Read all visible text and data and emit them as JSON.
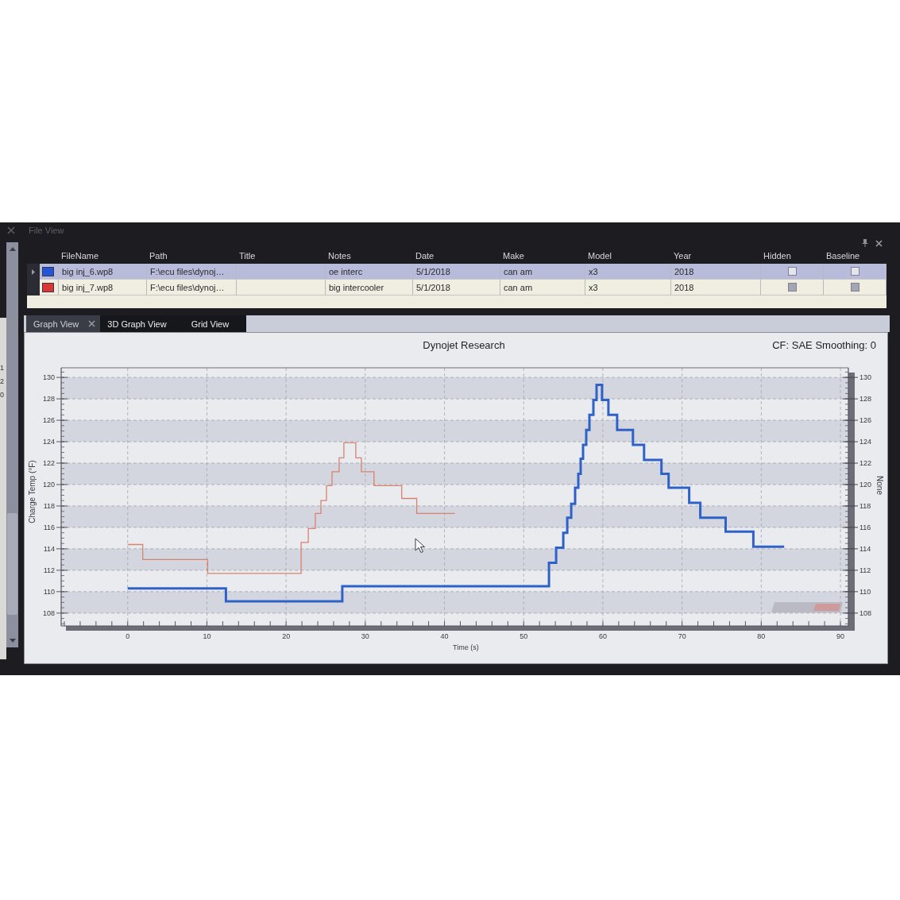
{
  "window": {
    "title": "File View"
  },
  "left_edge": {
    "lines": [
      "1",
      "2",
      "0"
    ]
  },
  "file_view": {
    "columns": [
      "FileName",
      "Path",
      "Title",
      "Notes",
      "Date",
      "Make",
      "Model",
      "Year",
      "Hidden",
      "Baseline"
    ],
    "rows": [
      {
        "selected": true,
        "color": "#2454d8",
        "file_name": "big inj_6.wp8",
        "path": "F:\\ecu files\\dynoj…",
        "notes": "oe interc",
        "date": "5/1/2018",
        "make": "can am",
        "model": "x3",
        "year": "2018",
        "hidden": false,
        "baseline": false
      },
      {
        "selected": false,
        "color": "#dd3535",
        "file_name": "big inj_7.wp8",
        "path": "F:\\ecu files\\dynoj…",
        "notes": "big intercooler",
        "date": "5/1/2018",
        "make": "can am",
        "model": "x3",
        "year": "2018",
        "hidden": false,
        "baseline": false
      }
    ]
  },
  "tabs": [
    {
      "label": "Graph View",
      "selected": true,
      "closable": true
    },
    {
      "label": "3D Graph View",
      "selected": false,
      "closable": false
    },
    {
      "label": "Grid View",
      "selected": false,
      "closable": false
    }
  ],
  "graph": {
    "title": "Dynojet Research",
    "settings": "CF: SAE Smoothing: 0",
    "chart_data": {
      "type": "line",
      "xlabel": "Time (s)",
      "ylabel": "Charge Temp (°F)",
      "grid": true,
      "x": [
        0,
        1.9,
        1.9,
        10.1,
        10.1,
        12.4,
        12.4,
        21.9,
        21.9,
        22.8,
        22.8,
        23.7,
        23.7,
        24.4,
        24.4,
        25.1,
        25.1,
        25.8,
        25.8,
        26.7,
        26.7,
        27.1,
        27.1,
        27.3,
        27.3,
        28.8,
        28.8,
        29.5,
        29.5,
        31.1,
        31.1,
        34.6,
        34.6,
        36.5,
        36.5,
        41.3,
        53.2,
        53.2,
        54.1,
        54.1,
        55.0,
        55.0,
        55.5,
        55.5,
        56.0,
        56.0,
        56.5,
        56.5,
        56.9,
        56.9,
        57.2,
        57.2,
        57.5,
        57.5,
        57.9,
        57.9,
        58.3,
        58.3,
        58.8,
        58.8,
        59.2,
        59.2,
        59.9,
        59.9,
        60.7,
        60.7,
        61.8,
        61.8,
        63.8,
        63.8,
        65.2,
        65.2,
        67.4,
        67.4,
        68.3,
        68.3,
        70.9,
        70.9,
        72.3,
        72.3,
        75.5,
        75.5,
        79.0,
        79.0,
        82.9
      ],
      "series": [
        {
          "color": "#2f62c8",
          "values": [
            110.3,
            110.3,
            110.3,
            110.3,
            110.3,
            110.3,
            109.1,
            109.1,
            109.1,
            109.1,
            109.1,
            109.1,
            109.1,
            109.1,
            109.1,
            109.1,
            109.1,
            109.1,
            109.1,
            109.1,
            109.1,
            109.1,
            110.5,
            110.5,
            110.5,
            110.5,
            110.5,
            110.5,
            110.5,
            110.5,
            110.5,
            110.5,
            110.5,
            110.5,
            110.5,
            110.5,
            110.5,
            112.7,
            112.7,
            114.1,
            114.1,
            115.5,
            115.5,
            116.9,
            116.9,
            118.2,
            118.2,
            119.7,
            119.7,
            121.0,
            121.0,
            122.4,
            122.4,
            123.7,
            123.7,
            125.1,
            125.1,
            126.5,
            126.5,
            127.9,
            127.9,
            129.3,
            129.3,
            127.9,
            127.9,
            126.5,
            126.5,
            125.1,
            125.1,
            123.7,
            123.7,
            122.3,
            122.3,
            121.0,
            121.0,
            119.7,
            119.7,
            118.3,
            118.3,
            116.9,
            116.9,
            115.6,
            115.6,
            114.2,
            114.2
          ]
        },
        {
          "color": "#d9826e",
          "values": [
            114.4,
            114.4,
            113.0,
            113.0,
            111.7,
            111.7,
            111.7,
            111.7,
            114.6,
            114.6,
            115.9,
            115.9,
            117.3,
            117.3,
            118.5,
            118.5,
            119.9,
            119.9,
            121.2,
            121.2,
            122.5,
            122.5,
            122.5,
            122.5,
            123.9,
            123.9,
            122.5,
            122.5,
            121.2,
            121.2,
            119.9,
            119.9,
            118.7,
            118.7,
            117.3,
            117.3,
            null,
            null,
            null,
            null,
            null,
            null,
            null,
            null,
            null,
            null,
            null,
            null,
            null,
            null,
            null,
            null,
            null,
            null,
            null,
            null,
            null,
            null,
            null,
            null,
            null,
            null,
            null,
            null,
            null,
            null,
            null,
            null,
            null,
            null,
            null,
            null,
            null,
            null,
            null,
            null,
            null,
            null,
            null,
            null,
            null,
            null,
            null,
            null,
            null
          ]
        }
      ],
      "xlim": [
        -8.4,
        91
      ],
      "ylim": [
        106.8,
        130.9
      ],
      "xticks": [
        0,
        10,
        20,
        30,
        40,
        50,
        60,
        70,
        80,
        90
      ],
      "yticks": [
        108,
        110,
        112,
        114,
        116,
        118,
        120,
        122,
        124,
        126,
        128,
        130
      ]
    },
    "right_axis": {
      "label": "None",
      "ticks": [
        "130",
        "128",
        "126",
        "124",
        "122",
        "120",
        "118",
        "116",
        "114",
        "112",
        "110",
        "108"
      ]
    }
  }
}
